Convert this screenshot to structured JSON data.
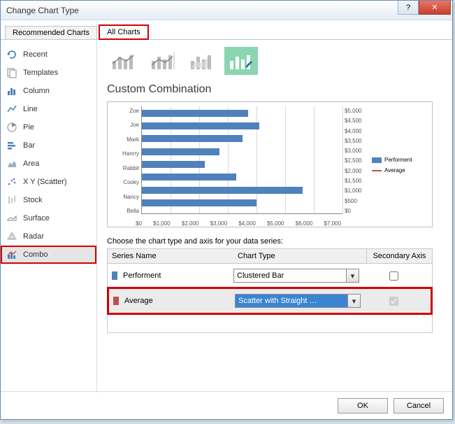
{
  "titlebar": {
    "title": "Change Chart Type"
  },
  "tabs": {
    "recommended": "Recommended Charts",
    "all": "All Charts"
  },
  "sidebar": {
    "items": [
      {
        "label": "Recent",
        "icon": "recent-icon"
      },
      {
        "label": "Templates",
        "icon": "templates-icon"
      },
      {
        "label": "Column",
        "icon": "column-icon"
      },
      {
        "label": "Line",
        "icon": "line-icon"
      },
      {
        "label": "Pie",
        "icon": "pie-icon"
      },
      {
        "label": "Bar",
        "icon": "bar-icon"
      },
      {
        "label": "Area",
        "icon": "area-icon"
      },
      {
        "label": "X Y (Scatter)",
        "icon": "scatter-icon"
      },
      {
        "label": "Stock",
        "icon": "stock-icon"
      },
      {
        "label": "Surface",
        "icon": "surface-icon"
      },
      {
        "label": "Radar",
        "icon": "radar-icon"
      },
      {
        "label": "Combo",
        "icon": "combo-icon"
      }
    ]
  },
  "main_heading": "Custom Combination",
  "series_caption": "Choose the chart type and axis for your data series:",
  "series_header": {
    "name": "Series Name",
    "type": "Chart Type",
    "axis": "Secondary Axis"
  },
  "series_rows": [
    {
      "name": "Performent",
      "type": "Clustered Bar",
      "secondary": false
    },
    {
      "name": "Average",
      "type": "Scatter with Straight …",
      "secondary": true
    }
  ],
  "footer": {
    "ok": "OK",
    "cancel": "Cancel"
  },
  "chart_data": {
    "type": "bar",
    "orientation": "horizontal",
    "categories": [
      "Zoe",
      "Joe",
      "Mark",
      "Hanrry",
      "Rabbit",
      "Cooky",
      "Nancy",
      "Bella"
    ],
    "series": [
      {
        "name": "Performent",
        "values": [
          3700,
          4100,
          3500,
          2700,
          2200,
          3300,
          5600,
          4000
        ],
        "color": "#4f81bd"
      },
      {
        "name": "Average",
        "values": [],
        "color": "#c0504d"
      }
    ],
    "xlabel": "",
    "ylabel": "",
    "xlim": [
      0,
      7000
    ],
    "x_ticks": [
      "$0",
      "$1,000",
      "$2,000",
      "$3,000",
      "$4,000",
      "$5,000",
      "$6,000",
      "$7,000"
    ],
    "secondary_y_ticks": [
      "$5,000",
      "$4,500",
      "$4,000",
      "$3,500",
      "$3,000",
      "$2,500",
      "$2,000",
      "$1,500",
      "$1,000",
      "$500",
      "$0"
    ],
    "legend": [
      "Performent",
      "Average"
    ]
  }
}
